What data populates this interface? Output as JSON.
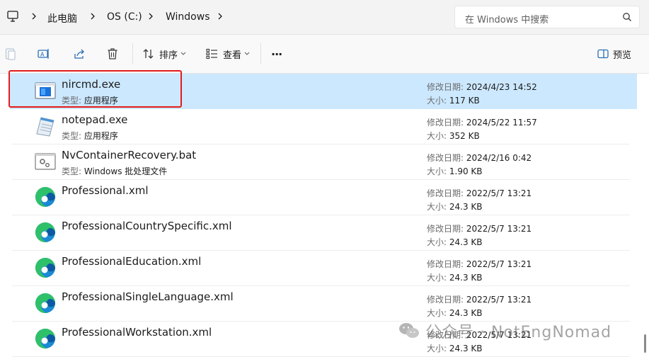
{
  "breadcrumb": {
    "items": [
      "此电脑",
      "OS (C:)",
      "Windows"
    ]
  },
  "search": {
    "placeholder": "在 Windows 中搜索"
  },
  "toolbar": {
    "sort_label": "排序",
    "view_label": "查看",
    "more_label": "···",
    "preview_label": "预览"
  },
  "labels": {
    "type_key": "类型:",
    "modified_key": "修改日期:",
    "size_key": "大小:"
  },
  "files": [
    {
      "name": "nircmd.exe",
      "type": "应用程序",
      "modified": "2024/4/23 14:52",
      "size": "117 KB",
      "icon": "exe-window-icon",
      "selected": true
    },
    {
      "name": "notepad.exe",
      "type": "应用程序",
      "modified": "2024/5/22 11:57",
      "size": "352 KB",
      "icon": "notepad-icon",
      "selected": false
    },
    {
      "name": "NvContainerRecovery.bat",
      "type": "Windows 批处理文件",
      "modified": "2024/2/16 0:42",
      "size": "1.90 KB",
      "icon": "batch-file-icon",
      "selected": false
    },
    {
      "name": "Professional.xml",
      "type": "",
      "modified": "2022/5/7 13:21",
      "size": "24.3 KB",
      "icon": "edge-icon",
      "selected": false
    },
    {
      "name": "ProfessionalCountrySpecific.xml",
      "type": "",
      "modified": "2022/5/7 13:21",
      "size": "24.3 KB",
      "icon": "edge-icon",
      "selected": false
    },
    {
      "name": "ProfessionalEducation.xml",
      "type": "",
      "modified": "2022/5/7 13:21",
      "size": "24.3 KB",
      "icon": "edge-icon",
      "selected": false
    },
    {
      "name": "ProfessionalSingleLanguage.xml",
      "type": "",
      "modified": "2022/5/7 13:21",
      "size": "24.3 KB",
      "icon": "edge-icon",
      "selected": false
    },
    {
      "name": "ProfessionalWorkstation.xml",
      "type": "",
      "modified": "2022/5/7 13:21",
      "size": "24.3 KB",
      "icon": "edge-icon",
      "selected": false
    }
  ],
  "watermark": {
    "text": "公众号 · NotEngNomad"
  },
  "colors": {
    "selection": "#cce8ff",
    "highlight_border": "#e51b1b",
    "accent": "#0067c0",
    "address_bar": "#f3f3f3",
    "toolbar": "#f9f9f9"
  }
}
